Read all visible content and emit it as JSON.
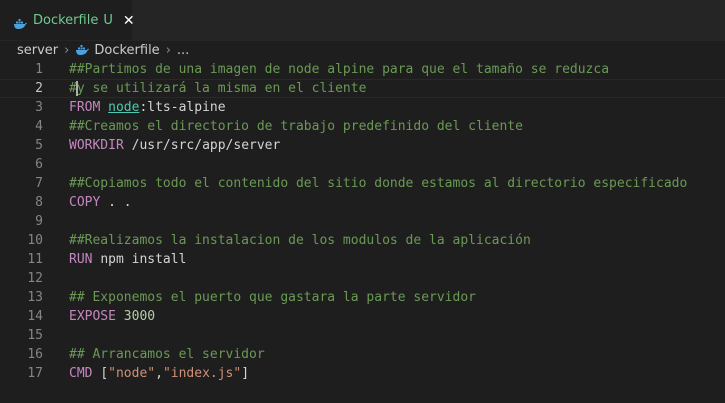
{
  "tab": {
    "label": "Dockerfile",
    "status": "U",
    "close_glyph": "✕",
    "icon": "docker-whale-icon",
    "color": "#73c991"
  },
  "breadcrumb": {
    "folder": "server",
    "separator": "›",
    "file": "Dockerfile",
    "ellipsis": "..."
  },
  "editor": {
    "current_line": 2,
    "lines": [
      {
        "n": "1",
        "tokens": [
          {
            "t": "##Partimos de una imagen de node alpine para que el tamaño se reduzca",
            "c": "cm"
          }
        ]
      },
      {
        "n": "2",
        "tokens": [
          {
            "t": "#",
            "c": "cm"
          },
          {
            "t": "",
            "c": "cursor"
          },
          {
            "t": "y se utilizará la misma en el cliente",
            "c": "cm"
          }
        ]
      },
      {
        "n": "3",
        "tokens": [
          {
            "t": "FROM ",
            "c": "kw"
          },
          {
            "t": "node",
            "c": "img"
          },
          {
            "t": ":lts-alpine",
            "c": "tx"
          }
        ]
      },
      {
        "n": "4",
        "tokens": [
          {
            "t": "##Creamos el directorio de trabajo predefinido del cliente",
            "c": "cm"
          }
        ]
      },
      {
        "n": "5",
        "tokens": [
          {
            "t": "WORKDIR ",
            "c": "kw"
          },
          {
            "t": "/usr/src/app/server",
            "c": "tx"
          }
        ]
      },
      {
        "n": "6",
        "tokens": []
      },
      {
        "n": "7",
        "tokens": [
          {
            "t": "##Copiamos todo el contenido del sitio donde estamos al directorio especificado",
            "c": "cm"
          }
        ]
      },
      {
        "n": "8",
        "tokens": [
          {
            "t": "COPY ",
            "c": "kw"
          },
          {
            "t": ". .",
            "c": "tx"
          }
        ]
      },
      {
        "n": "9",
        "tokens": []
      },
      {
        "n": "10",
        "tokens": [
          {
            "t": "##Realizamos la instalacion de los modulos de la aplicación",
            "c": "cm"
          }
        ]
      },
      {
        "n": "11",
        "tokens": [
          {
            "t": "RUN ",
            "c": "kw"
          },
          {
            "t": "npm install",
            "c": "tx"
          }
        ]
      },
      {
        "n": "12",
        "tokens": []
      },
      {
        "n": "13",
        "tokens": [
          {
            "t": "## Exponemos el puerto que gastara la parte servidor",
            "c": "cm"
          }
        ]
      },
      {
        "n": "14",
        "tokens": [
          {
            "t": "EXPOSE ",
            "c": "kw"
          },
          {
            "t": "3000",
            "c": "num"
          }
        ]
      },
      {
        "n": "15",
        "tokens": []
      },
      {
        "n": "16",
        "tokens": [
          {
            "t": "## Arrancamos el servidor",
            "c": "cm"
          }
        ]
      },
      {
        "n": "17",
        "tokens": [
          {
            "t": "CMD ",
            "c": "kw"
          },
          {
            "t": "[",
            "c": "tx"
          },
          {
            "t": "\"node\"",
            "c": "str"
          },
          {
            "t": ",",
            "c": "tx"
          },
          {
            "t": "\"index.js\"",
            "c": "str"
          },
          {
            "t": "]",
            "c": "tx"
          }
        ]
      }
    ]
  }
}
